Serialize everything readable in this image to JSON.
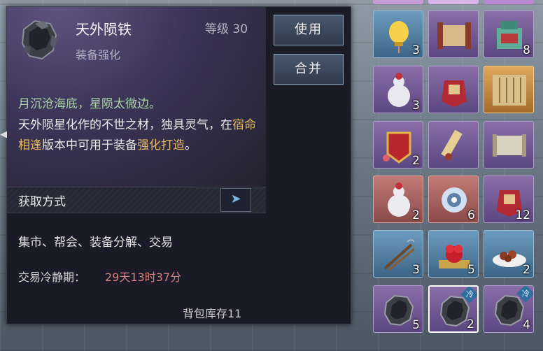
{
  "tooltip": {
    "title": "天外陨铁",
    "level": "等级 30",
    "subtitle": "装备强化",
    "poem": "月沉沧海底，星陨太微边。",
    "desc_part1": "天外陨星化作的不世之材，独具灵气，在",
    "desc_highlight1": "宿命相逢",
    "desc_part2": "版本中可用于装备",
    "desc_highlight2": "强化打造",
    "desc_part3": "。",
    "section_label": "获取方式",
    "sources": "集市、帮会、装备分解、交易",
    "cooldown_label": "交易冷静期：",
    "cooldown_value": "29天13时37分",
    "stock": "背包库存11",
    "use_button": "使用",
    "merge_button": "合并",
    "arrow_icon": "chevron-right-icon",
    "left_arrow_icon": "chevron-left-icon"
  },
  "colors": {
    "highlight": "#e7ba60",
    "poem": "#a9d3a7",
    "cooldown": "#d98080"
  },
  "inventory": [
    {
      "row": 0,
      "items": [
        {
          "name": "lantern-icon",
          "rarity": "blue",
          "count": "3"
        },
        {
          "name": "map-scroll-icon",
          "rarity": "purple",
          "count": ""
        },
        {
          "name": "jade-seal-icon",
          "rarity": "purple",
          "count": "8"
        }
      ]
    },
    {
      "row": 1,
      "items": [
        {
          "name": "wine-gourd-icon",
          "rarity": "purple",
          "count": "3"
        },
        {
          "name": "red-pouch-icon",
          "rarity": "purple",
          "count": ""
        },
        {
          "name": "bamboo-book-icon",
          "rarity": "gold",
          "count": ""
        }
      ]
    },
    {
      "row": 2,
      "items": [
        {
          "name": "red-token-icon",
          "rarity": "purple",
          "count": "2"
        },
        {
          "name": "scroll-icon",
          "rarity": "purple",
          "count": ""
        },
        {
          "name": "paper-scroll-icon",
          "rarity": "purple",
          "count": ""
        }
      ]
    },
    {
      "row": 3,
      "items": [
        {
          "name": "wine-jar-icon",
          "rarity": "red",
          "count": "2"
        },
        {
          "name": "moon-orb-icon",
          "rarity": "red",
          "count": "6"
        },
        {
          "name": "red-pouch-icon",
          "rarity": "purple",
          "count": "12"
        }
      ]
    },
    {
      "row": 4,
      "items": [
        {
          "name": "incense-sticks-icon",
          "rarity": "blue",
          "count": "3"
        },
        {
          "name": "firecracker-icon",
          "rarity": "blue",
          "count": "5"
        },
        {
          "name": "food-plate-icon",
          "rarity": "blue",
          "count": "2"
        }
      ]
    },
    {
      "row": 5,
      "items": [
        {
          "name": "meteor-iron-icon",
          "rarity": "purple",
          "count": "5",
          "locked": false
        },
        {
          "name": "meteor-iron-icon",
          "rarity": "purple",
          "count": "2",
          "locked": true,
          "selected": true
        },
        {
          "name": "meteor-iron-icon",
          "rarity": "purple",
          "count": "4",
          "locked": true
        }
      ]
    }
  ],
  "lock_badge_text": "冷"
}
